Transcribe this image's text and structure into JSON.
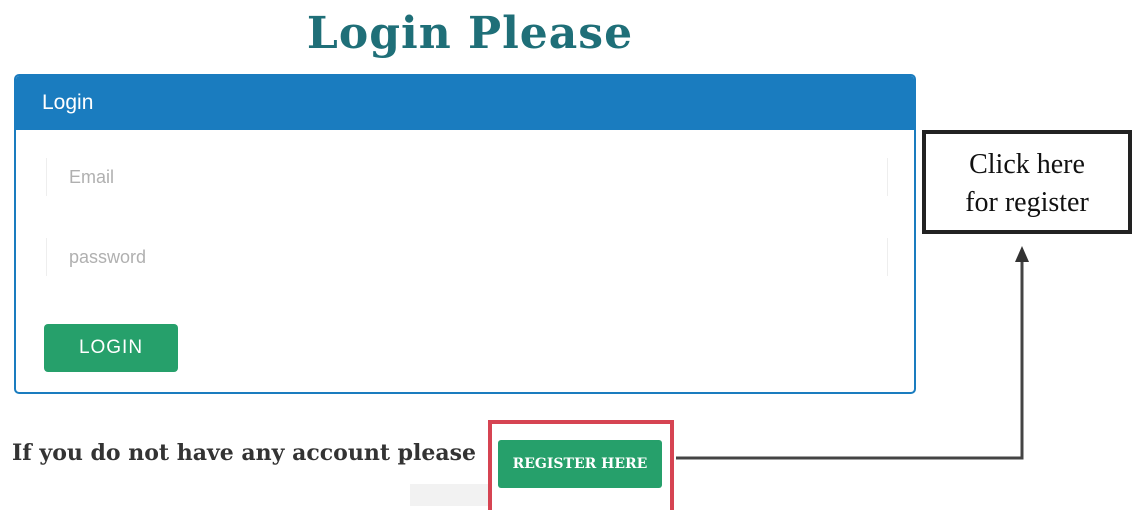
{
  "page": {
    "title": "Login Please"
  },
  "login_panel": {
    "header": "Login",
    "email_placeholder": "Email",
    "password_placeholder": "password",
    "login_label": "LOGIN"
  },
  "register": {
    "prompt": "If you do not have any account please",
    "button_label": "REGISTER HERE"
  },
  "callout": {
    "line1": "Click here",
    "line2": "for register"
  },
  "colors": {
    "title": "#1f6f78",
    "panel_header": "#1a7cbf",
    "button_green": "#26a06b",
    "highlight_red": "#d64452",
    "callout_border": "#222222"
  }
}
